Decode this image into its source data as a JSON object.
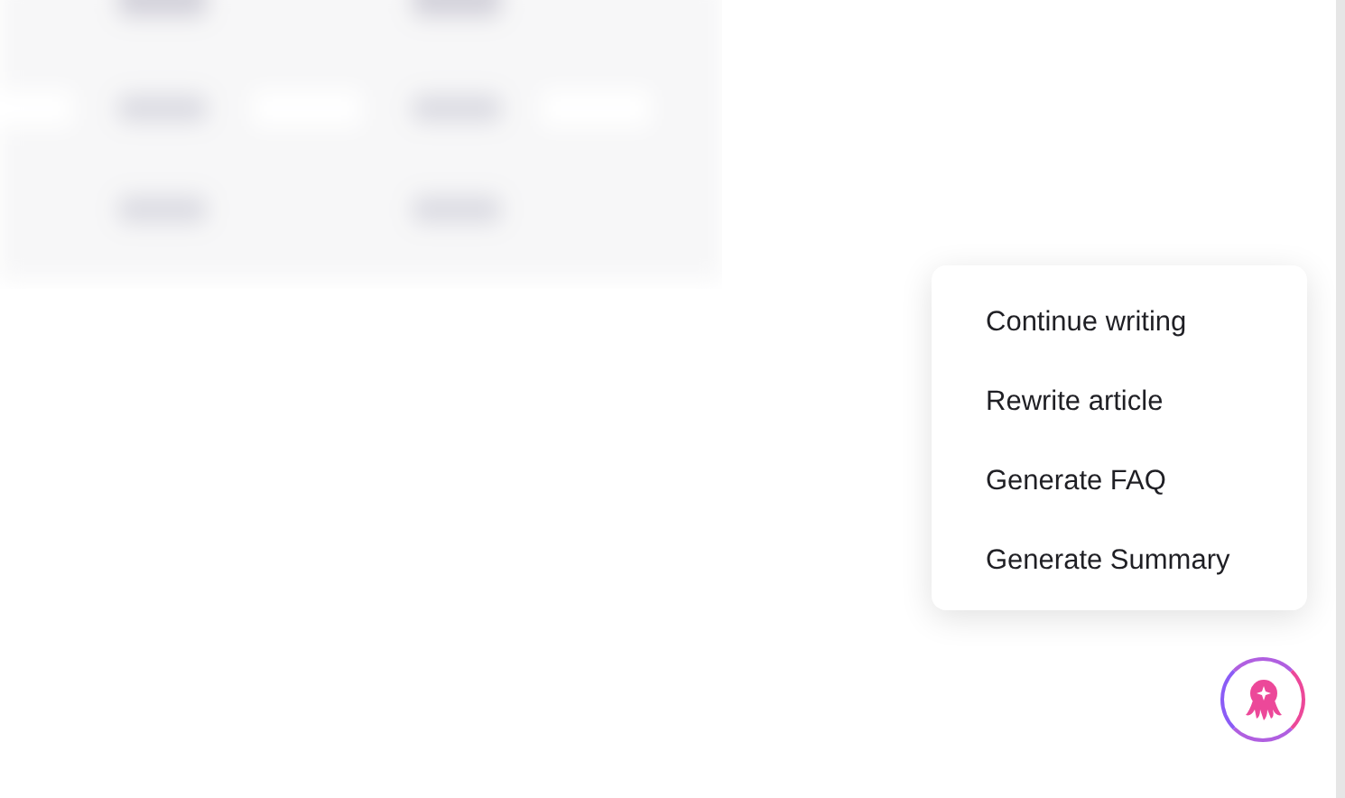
{
  "menu": {
    "items": [
      {
        "label": "Continue writing"
      },
      {
        "label": "Rewrite article"
      },
      {
        "label": "Generate FAQ"
      },
      {
        "label": "Generate Summary"
      }
    ]
  }
}
